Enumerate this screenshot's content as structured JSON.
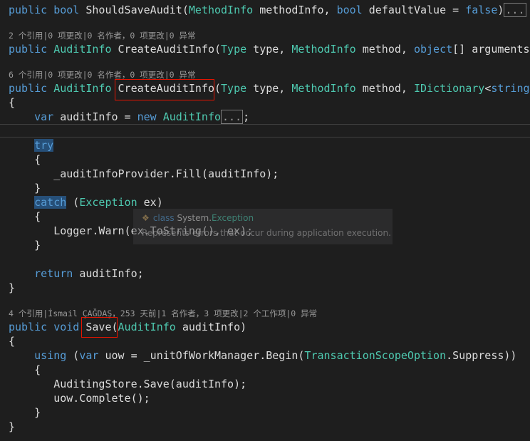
{
  "lines": {
    "l1_public": "public",
    "l1_bool": "bool",
    "l1_name": "ShouldSaveAudit(",
    "l1_type": "MethodInfo",
    "l1_arg1": " methodInfo, ",
    "l1_bool2": "bool",
    "l1_arg2": " defaultValue = ",
    "l1_false": "false",
    "l1_close": ")",
    "ellipsis": "...",
    "lens1": "2 个引用|0 项更改|0 名作者，0 项更改|0 异常",
    "l2_public": "public",
    "l2_ret": "AuditInfo",
    "l2_name": "CreateAuditInfo(",
    "l2_type1": "Type",
    "l2_arg1": " type, ",
    "l2_type2": "MethodInfo",
    "l2_arg2": " method, ",
    "l2_obj": "object",
    "l2_arg3": "[] arguments)",
    "lens2": "6 个引用|0 项更改|0 名作者，0 项更改|0 异常",
    "l3_public": "public",
    "l3_ret": "AuditInfo",
    "l3_name": "CreateAuditInfo",
    "l3_paren": "(",
    "l3_type1": "Type",
    "l3_arg1": " type, ",
    "l3_type2": "MethodInfo",
    "l3_arg2": " method, ",
    "l3_type3": "IDictionary",
    "l3_lt": "<",
    "l3_string": "string",
    "l3_comma": ",",
    "brace_open": "{",
    "brace_close": "}",
    "l4_var": "var",
    "l4_mid": " auditInfo = ",
    "l4_new": "new",
    "l4_type": "AuditInfo",
    "semicolon": ";",
    "try": "try",
    "fill_call": "_auditInfoProvider.Fill(auditInfo);",
    "catch": "catch",
    "catch_open": " (",
    "exception": "Exception",
    "catch_close": " ex)",
    "logger": "Logger.Warn(ex.ToString(), ex);",
    "return": "return",
    "return_rest": " auditInfo;",
    "lens3": "4 个引用|İsmail ÇAĞDAŞ，253 天前|1 名作者，3 项更改|2 个工作项|0 异常",
    "l5_public": "public",
    "l5_void": "void",
    "l5_name": "Save",
    "l5_paren": "(",
    "l5_type": "AuditInfo",
    "l5_arg": " auditInfo)",
    "using": "using",
    "using_open": " (",
    "using_var": "var",
    "using_mid": " uow = _unitOfWorkManager.Begin(",
    "using_type": "TransactionScopeOption",
    "using_end": ".Suppress))",
    "store_save": "AuditingStore.Save(auditInfo);",
    "complete": "uow.Complete();"
  },
  "tooltip": {
    "icon": "class-icon",
    "kind": "class",
    "namespace": "System.",
    "classname": "Exception",
    "description": "Represents errors that occur during application execution."
  },
  "colors": {
    "background": "#1e1e1e",
    "keyword": "#569cd6",
    "type": "#4ec9b0",
    "text": "#dcdcdc",
    "codelens": "#999999",
    "highlight": "#264f78",
    "red_box": "#e51400"
  }
}
